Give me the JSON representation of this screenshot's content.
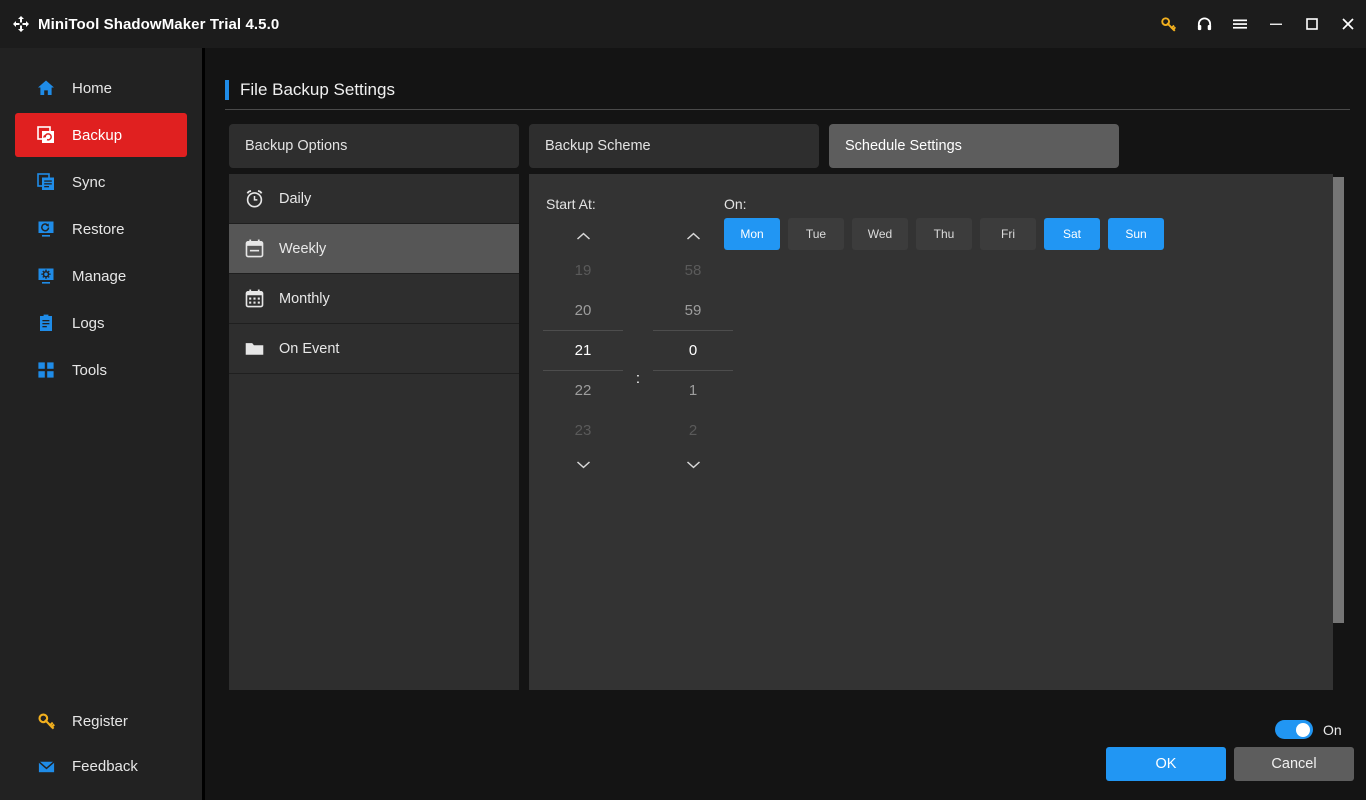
{
  "titlebar": {
    "app_title": "MiniTool ShadowMaker Trial 4.5.0",
    "logo_icon": "refresh-arrows-icon",
    "buttons": [
      {
        "name": "key-icon",
        "label": "Key",
        "color": "#f2b01e"
      },
      {
        "name": "headset-icon",
        "label": "Support",
        "color": "#ffffff"
      },
      {
        "name": "menu-icon",
        "label": "Menu",
        "color": "#ffffff"
      },
      {
        "name": "minimize-icon",
        "label": "Minimize",
        "color": "#ffffff"
      },
      {
        "name": "maximize-icon",
        "label": "Maximize",
        "color": "#ffffff"
      },
      {
        "name": "close-icon",
        "label": "Close",
        "color": "#ffffff"
      }
    ]
  },
  "sidebar": {
    "active_index": 1,
    "accent_color": "#e02020",
    "items": [
      {
        "label": "Home",
        "icon": "home-icon"
      },
      {
        "label": "Backup",
        "icon": "backup-icon"
      },
      {
        "label": "Sync",
        "icon": "sync-icon"
      },
      {
        "label": "Restore",
        "icon": "restore-icon"
      },
      {
        "label": "Manage",
        "icon": "manage-icon"
      },
      {
        "label": "Logs",
        "icon": "logs-icon"
      },
      {
        "label": "Tools",
        "icon": "tools-icon"
      }
    ],
    "bottom_items": [
      {
        "label": "Register",
        "icon": "key-icon"
      },
      {
        "label": "Feedback",
        "icon": "envelope-icon"
      }
    ]
  },
  "page": {
    "title": "File Backup Settings",
    "accent_color": "#1f8ce8"
  },
  "tabs": {
    "active_index": 2,
    "items": [
      {
        "label": "Backup Options"
      },
      {
        "label": "Backup Scheme"
      },
      {
        "label": "Schedule Settings"
      }
    ]
  },
  "schedule_list": {
    "selected_index": 1,
    "items": [
      {
        "label": "Daily",
        "icon": "alarm-clock-icon"
      },
      {
        "label": "Weekly",
        "icon": "calendar-icon"
      },
      {
        "label": "Monthly",
        "icon": "calendar-grid-icon"
      },
      {
        "label": "On Event",
        "icon": "folder-icon"
      }
    ]
  },
  "schedule_settings": {
    "start_at_label": "Start At:",
    "on_label": "On:",
    "hour": {
      "up_icon": "chevron-up-icon",
      "down_icon": "chevron-down-icon",
      "values": [
        "19",
        "20",
        "21",
        "22",
        "23"
      ],
      "selected": "21",
      "selected_index": 2
    },
    "separator": ":",
    "minute": {
      "up_icon": "chevron-up-icon",
      "down_icon": "chevron-down-icon",
      "values": [
        "58",
        "59",
        "0",
        "1",
        "2"
      ],
      "selected": "0",
      "selected_index": 2
    },
    "days": [
      {
        "label": "Mon",
        "selected": true
      },
      {
        "label": "Tue",
        "selected": false
      },
      {
        "label": "Wed",
        "selected": false
      },
      {
        "label": "Thu",
        "selected": false
      },
      {
        "label": "Fri",
        "selected": false
      },
      {
        "label": "Sat",
        "selected": true
      },
      {
        "label": "Sun",
        "selected": true
      }
    ],
    "selected_color": "#2196f3"
  },
  "footer": {
    "toggle_label": "On",
    "toggle_on": true,
    "ok_label": "OK",
    "cancel_label": "Cancel"
  }
}
